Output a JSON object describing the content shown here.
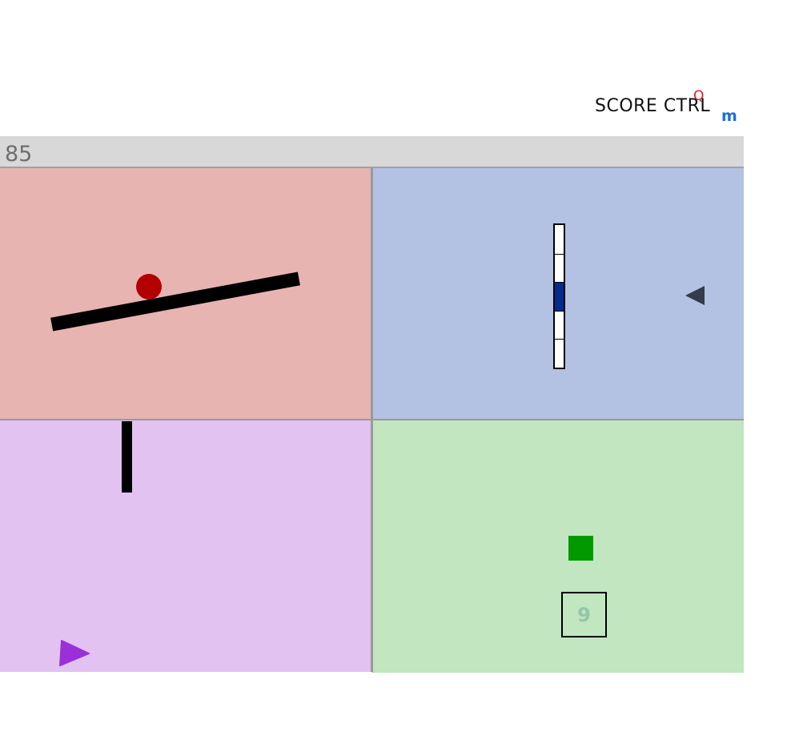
{
  "hud": {
    "score_label": "SCORE CTRL",
    "small_red_glyph": "Q",
    "small_blue_glyph": "m"
  },
  "topbar": {
    "counter": "85"
  },
  "panels": [
    {
      "name": "red",
      "color": "#e7b4b2"
    },
    {
      "name": "blue",
      "color": "#b3c2e2"
    },
    {
      "name": "purple",
      "color": "#e1c2f1"
    },
    {
      "name": "green",
      "color": "#c1e6c0"
    }
  ],
  "red_panel": {
    "ball_color": "#b30000",
    "beam_color": "#000000"
  },
  "blue_panel": {
    "slider_segments": 5,
    "slider_level_segment": 3,
    "slider_fill_color": "#002c8f",
    "pointer_icon": "triangle-left-icon"
  },
  "purple_panel": {
    "post_color": "#000000",
    "player_icon": "triangle-right-icon",
    "player_color": "#9b30d9"
  },
  "green_panel": {
    "square_color": "#009900",
    "box_number": "9"
  }
}
